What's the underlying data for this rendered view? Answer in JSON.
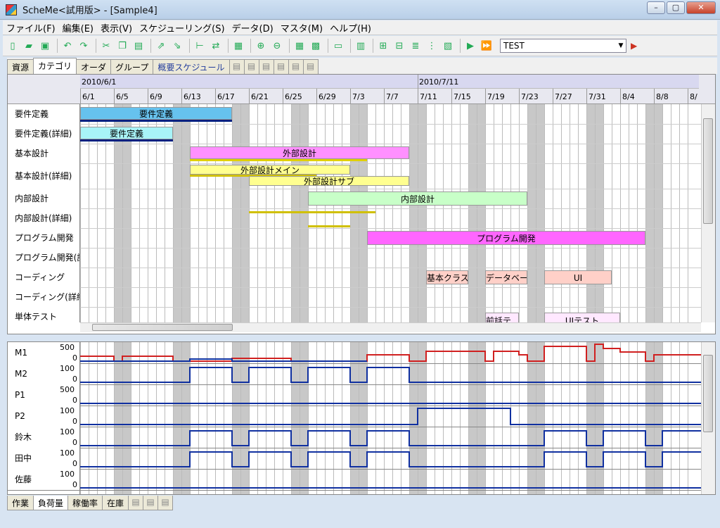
{
  "window": {
    "title": "ScheMe<試用版> - [Sample4]",
    "controls": [
      "–",
      "▢",
      "✕"
    ]
  },
  "menu": [
    {
      "label": "ファイル(F)",
      "name": "menu-file"
    },
    {
      "label": "編集(E)",
      "name": "menu-edit"
    },
    {
      "label": "表示(V)",
      "name": "menu-view"
    },
    {
      "label": "スケジューリング(S)",
      "name": "menu-scheduling"
    },
    {
      "label": "データ(D)",
      "name": "menu-data"
    },
    {
      "label": "マスタ(M)",
      "name": "menu-master"
    },
    {
      "label": "ヘルプ(H)",
      "name": "menu-help"
    }
  ],
  "toolbar": {
    "icons": [
      "new-file-icon",
      "open-folder-icon",
      "save-icon",
      "|",
      "undo-icon",
      "redo-icon",
      "|",
      "cut-icon",
      "copy-icon",
      "paste-icon",
      "|",
      "export-icon",
      "import-icon",
      "|",
      "tree-icon",
      "link-icon",
      "|",
      "calendar-icon",
      "|",
      "zoom-in-icon",
      "zoom-out-icon",
      "|",
      "grid-icon",
      "gantt-color-icon",
      "|",
      "split-icon",
      "|",
      "book-icon",
      "|",
      "assign-icon",
      "reassign-icon",
      "priority-icon",
      "sequence-icon",
      "resource-icon",
      "|",
      "run-icon",
      "fast-forward-icon"
    ],
    "combo_value": "TEST"
  },
  "top_tabs": [
    {
      "label": "資源",
      "active": false,
      "blue": false
    },
    {
      "label": "カテゴリ",
      "active": true,
      "blue": false
    },
    {
      "label": "オーダ",
      "active": false,
      "blue": false
    },
    {
      "label": "グループ",
      "active": false,
      "blue": false
    },
    {
      "label": "概要スケジュール",
      "active": false,
      "blue": true
    }
  ],
  "top_icon_tabs": [
    "add-tab-icon",
    "edit-tab-icon",
    "copy-tab-icon",
    "move-tab-icon",
    "page-icon",
    "print-icon"
  ],
  "bottom_tabs": [
    {
      "label": "作業",
      "active": false
    },
    {
      "label": "負荷量",
      "active": true
    },
    {
      "label": "稼働率",
      "active": false
    },
    {
      "label": "在庫",
      "active": false
    }
  ],
  "bottom_icon_tabs": [
    "add-tab-icon",
    "page-icon",
    "print-icon"
  ],
  "gantt": {
    "months": [
      "2010/6/1",
      "2010/7/11"
    ],
    "dates": [
      "6/1",
      "6/5",
      "6/9",
      "6/13",
      "6/17",
      "6/21",
      "6/25",
      "6/29",
      "7/3",
      "7/7",
      "7/11",
      "7/15",
      "7/19",
      "7/23",
      "7/27",
      "7/31",
      "8/4",
      "8/8",
      "8/"
    ],
    "rows": [
      "要件定義",
      "要件定義(詳細)",
      "基本設計",
      "基本設計(詳細)",
      "内部設計",
      "内部設計(詳細)",
      "プログラム開発",
      "プログラム開発(詳細",
      "コーディング",
      "コーディング(詳細)",
      "単体テスト"
    ],
    "bars": [
      {
        "label": "要件定義",
        "color": "#66c2ee"
      },
      {
        "label": "要件定義",
        "color": "#a8f4f8"
      },
      {
        "label": "外部設計",
        "color": "#ff90ff"
      },
      {
        "label": "外部設計メイン",
        "color": "#ffff90"
      },
      {
        "label": "外部設計サブ",
        "color": "#ffff90"
      },
      {
        "label": "内部設計",
        "color": "#c8ffc8"
      },
      {
        "label": "プログラム開発",
        "color": "#ff66ff"
      },
      {
        "label": "基本クラス",
        "color": "#ffd0c8"
      },
      {
        "label": "データベー…",
        "color": "#ffd0c8"
      },
      {
        "label": "UI",
        "color": "#ffd0c8"
      },
      {
        "label": "前話テ…",
        "color": "#ffe8ff"
      },
      {
        "label": "UIテスト",
        "color": "#ffe8ff"
      }
    ]
  },
  "load": {
    "rows": [
      {
        "name": "M1",
        "max": "500",
        "min": "0"
      },
      {
        "name": "M2",
        "max": "100",
        "min": "0"
      },
      {
        "name": "P1",
        "max": "500",
        "min": "0"
      },
      {
        "name": "P2",
        "max": "100",
        "min": "0"
      },
      {
        "name": "鈴木",
        "max": "100",
        "min": "0"
      },
      {
        "name": "田中",
        "max": "100",
        "min": "0"
      },
      {
        "name": "佐藤",
        "max": "100",
        "min": "0"
      }
    ]
  }
}
